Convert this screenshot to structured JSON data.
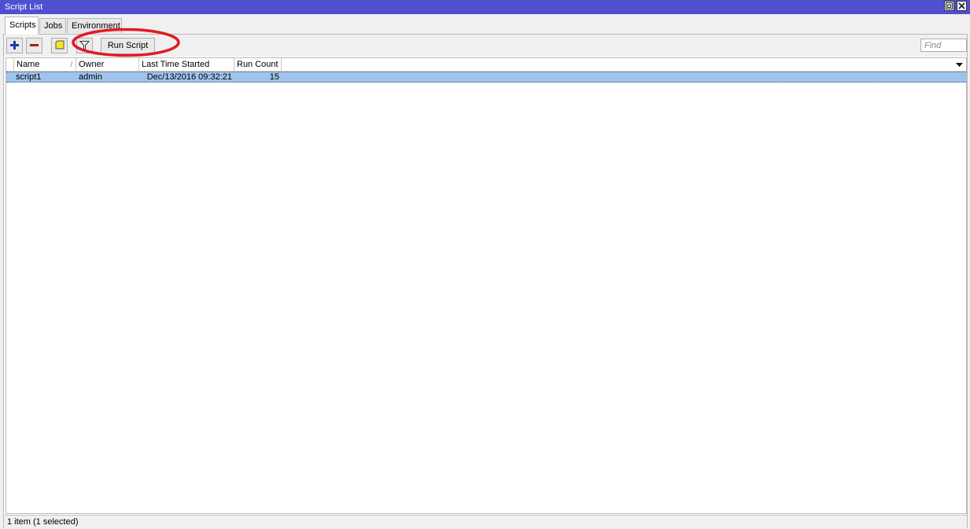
{
  "window": {
    "title": "Script List"
  },
  "tabs": [
    {
      "label": "Scripts",
      "active": true
    },
    {
      "label": "Jobs",
      "active": false
    },
    {
      "label": "Environment",
      "active": false
    }
  ],
  "toolbar": {
    "add_icon": "plus-icon",
    "remove_icon": "minus-icon",
    "comment_icon": "note-icon",
    "filter_icon": "filter-icon",
    "run_script_label": "Run Script",
    "find_placeholder": "Find"
  },
  "table": {
    "columns": [
      {
        "label": "Name",
        "sort": "/"
      },
      {
        "label": "Owner"
      },
      {
        "label": "Last Time Started"
      },
      {
        "label": "Run Count"
      }
    ],
    "rows": [
      {
        "name": "script1",
        "owner": "admin",
        "last_time_started": "Dec/13/2016 09:32:21",
        "run_count": "15",
        "selected": true
      }
    ]
  },
  "status": {
    "text": "1 item (1 selected)"
  },
  "colors": {
    "titlebar": "#4f4fcf",
    "selection": "#9fc4ec",
    "annotation": "#e01b24",
    "add_icon": "#1a3aa8",
    "remove_icon": "#b01b1b",
    "comment_icon": "#f3e81b"
  }
}
